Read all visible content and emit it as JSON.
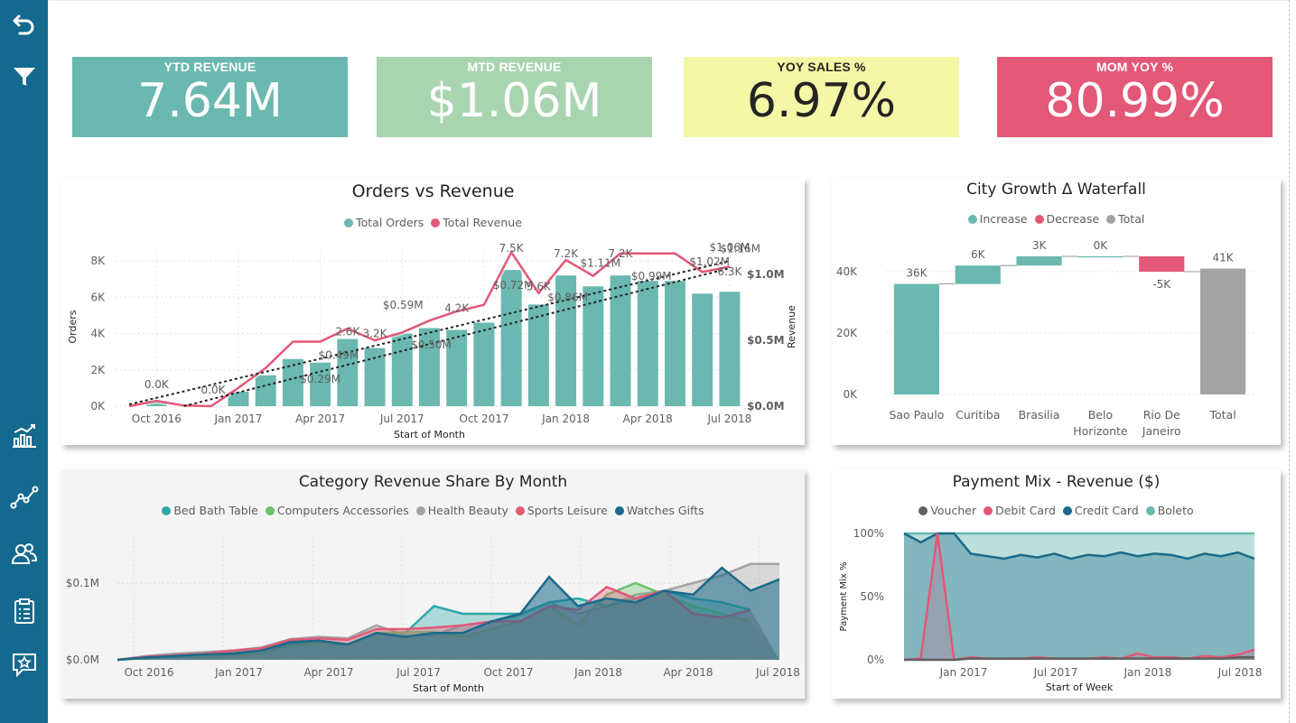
{
  "kpis": [
    {
      "label": "YTD REVENUE",
      "value": "7.64M",
      "bg": "#6ab8b0",
      "fg": "#ffffff",
      "labelColor": "#ffffff"
    },
    {
      "label": "MTD REVENUE",
      "value": "$1.06M",
      "bg": "#a8d5b0",
      "fg": "#ffffff",
      "labelColor": "#ffffff"
    },
    {
      "label": "YOY SALES %",
      "value": "6.97%",
      "bg": "#f4f7a6",
      "fg": "#252423",
      "labelColor": "#252423"
    },
    {
      "label": "MOM YOY %",
      "value": "80.99%",
      "bg": "#e35877",
      "fg": "#ffffff",
      "labelColor": "#ffffff"
    }
  ],
  "sidebar": {
    "icons": [
      "undo-icon",
      "filter-icon",
      "bar-chart-icon",
      "line-trend-icon",
      "users-icon",
      "clipboard-icon",
      "feedback-icon"
    ]
  },
  "charts": {
    "orders_revenue": {
      "title": "Orders vs Revenue",
      "legend": [
        "Total Orders",
        "Total Revenue"
      ],
      "xlabel": "Start of Month",
      "ylabel_left": "Orders",
      "ylabel_right": "Revenue",
      "xticks": [
        "Oct 2016",
        "Jan 2017",
        "Apr 2017",
        "Jul 2017",
        "Oct 2017",
        "Jan 2018",
        "Apr 2018",
        "Jul 2018"
      ],
      "yticks_left": [
        "0K",
        "2K",
        "4K",
        "6K",
        "8K"
      ],
      "yticks_right": [
        "$0.0M",
        "$0.5M",
        "$1.0M"
      ],
      "bar_labels": [
        "0.0K",
        "0.0K",
        "2.6K",
        "3.2K",
        "4.2K",
        "7.5K",
        "5.6K",
        "7.2K",
        "7.2K",
        "6.3K"
      ],
      "rev_labels": [
        "$0.29M",
        "$0.49M",
        "$0.59M",
        "$0.50M",
        "$0.72M",
        "$0.86M",
        "$1.11M",
        "$0.99M",
        "$1.02M",
        "$1.16M",
        "$1.06M"
      ]
    },
    "waterfall": {
      "title": "City Growth Δ Waterfall",
      "legend": [
        "Increase",
        "Decrease",
        "Total"
      ],
      "yticks": [
        "0K",
        "20K",
        "40K"
      ],
      "value_labels": [
        "36K",
        "6K",
        "3K",
        "0K",
        "-5K",
        "41K"
      ],
      "categories": [
        [
          "Sao Paulo"
        ],
        [
          "Curitiba"
        ],
        [
          "Brasilia"
        ],
        [
          "Belo",
          "Horizonte"
        ],
        [
          "Rio De",
          "Janeiro"
        ],
        [
          "Total"
        ]
      ]
    },
    "category_share": {
      "title": "Category Revenue Share By Month",
      "legend": [
        "Bed Bath Table",
        "Computers Accessories",
        "Health Beauty",
        "Sports Leisure",
        "Watches Gifts"
      ],
      "xlabel": "Start of Month",
      "xticks": [
        "Oct 2016",
        "Jan 2017",
        "Apr 2017",
        "Jul 2017",
        "Oct 2017",
        "Jan 2018",
        "Apr 2018",
        "Jul 2018"
      ],
      "yticks": [
        "$0.0M",
        "$0.1M"
      ]
    },
    "payment_mix": {
      "title": "Payment Mix - Revenue ($)",
      "legend": [
        "Voucher",
        "Debit Card",
        "Credit Card",
        "Boleto"
      ],
      "xlabel": "Start of Week",
      "ylabel": "Payment Mix %",
      "xticks": [
        "Jan 2017",
        "Jul 2017",
        "Jan 2018",
        "Jul 2018"
      ],
      "yticks": [
        "0%",
        "50%",
        "100%"
      ]
    }
  },
  "chart_data": [
    {
      "type": "bar",
      "title": "Orders vs Revenue",
      "xlabel": "Start of Month",
      "ylabel": "Orders",
      "ylabel_right": "Revenue",
      "categories": [
        "Sep 2016",
        "Oct 2016",
        "Nov 2016",
        "Dec 2016",
        "Jan 2017",
        "Feb 2017",
        "Mar 2017",
        "Apr 2017",
        "May 2017",
        "Jun 2017",
        "Jul 2017",
        "Aug 2017",
        "Sep 2017",
        "Oct 2017",
        "Nov 2017",
        "Dec 2017",
        "Jan 2018",
        "Feb 2018",
        "Mar 2018",
        "Apr 2018",
        "May 2018",
        "Jun 2018",
        "Jul 2018"
      ],
      "ylim": [
        0,
        8700
      ],
      "y2lim": [
        0,
        1200000
      ],
      "series": [
        {
          "name": "Total Orders",
          "values": [
            0,
            300,
            0,
            0,
            800,
            1700,
            2600,
            2400,
            3700,
            3200,
            4000,
            4300,
            4200,
            4600,
            7500,
            5600,
            7200,
            6600,
            7200,
            6900,
            6900,
            6200,
            6300
          ]
        },
        {
          "name": "Total Revenue",
          "values": [
            0,
            40000,
            5000,
            0,
            140000,
            290000,
            490000,
            490000,
            590000,
            500000,
            560000,
            650000,
            720000,
            770000,
            1170000,
            860000,
            1110000,
            990000,
            1160000,
            1160000,
            1160000,
            1020000,
            1060000
          ]
        }
      ],
      "colors": {
        "Total Orders": "#6ab8b0",
        "Total Revenue": "#e35877"
      }
    },
    {
      "type": "bar",
      "subtype": "waterfall",
      "title": "City Growth Δ Waterfall",
      "categories": [
        "Sao Paulo",
        "Curitiba",
        "Brasilia",
        "Belo Horizonte",
        "Rio De Janeiro",
        "Total"
      ],
      "values": [
        36000,
        6000,
        3000,
        0,
        -5000,
        41000
      ],
      "kinds": [
        "increase",
        "increase",
        "increase",
        "increase",
        "decrease",
        "total"
      ],
      "ylim": [
        0,
        50000
      ],
      "colors": {
        "Increase": "#6ab8b0",
        "Decrease": "#e35877",
        "Total": "#a3a3a3"
      }
    },
    {
      "type": "area",
      "title": "Category Revenue Share By Month",
      "xlabel": "Start of Month",
      "x": [
        "Sep 2016",
        "Oct 2016",
        "Nov 2016",
        "Dec 2016",
        "Jan 2017",
        "Feb 2017",
        "Mar 2017",
        "Apr 2017",
        "May 2017",
        "Jun 2017",
        "Jul 2017",
        "Aug 2017",
        "Sep 2017",
        "Oct 2017",
        "Nov 2017",
        "Dec 2017",
        "Jan 2018",
        "Feb 2018",
        "Mar 2018",
        "Apr 2018",
        "May 2018",
        "Jul 2018"
      ],
      "ylim": [
        0,
        0.16
      ],
      "series": [
        {
          "name": "Health Beauty",
          "values": [
            0,
            0.005,
            0.008,
            0.01,
            0.012,
            0.016,
            0.027,
            0.03,
            0.028,
            0.045,
            0.032,
            0.032,
            0.045,
            0.05,
            0.058,
            0.075,
            0.06,
            0.07,
            0.085,
            0.09,
            0.1,
            0.11,
            0.125,
            0.125
          ]
        },
        {
          "name": "Bed Bath Table",
          "values": [
            0,
            0.003,
            0.006,
            0.008,
            0.01,
            0.012,
            0.02,
            0.025,
            0.02,
            0.035,
            0.035,
            0.07,
            0.06,
            0.06,
            0.06,
            0.075,
            0.08,
            0.07,
            0.08,
            0.09,
            0.08,
            0.075,
            0.065
          ]
        },
        {
          "name": "Computers Accessories",
          "values": [
            0,
            0.002,
            0.004,
            0.005,
            0.006,
            0.008,
            0.018,
            0.022,
            0.02,
            0.035,
            0.036,
            0.036,
            0.03,
            0.04,
            0.05,
            0.07,
            0.045,
            0.085,
            0.1,
            0.085,
            0.07,
            0.06,
            0.05
          ]
        },
        {
          "name": "Sports Leisure",
          "values": [
            0,
            0.004,
            0.006,
            0.008,
            0.012,
            0.015,
            0.026,
            0.028,
            0.026,
            0.04,
            0.04,
            0.042,
            0.045,
            0.05,
            0.05,
            0.07,
            0.065,
            0.095,
            0.08,
            0.09,
            0.06,
            0.055,
            0.065
          ]
        },
        {
          "name": "Watches Gifts",
          "values": [
            0,
            0.003,
            0.005,
            0.007,
            0.008,
            0.012,
            0.023,
            0.025,
            0.02,
            0.035,
            0.03,
            0.035,
            0.035,
            0.05,
            0.06,
            0.108,
            0.07,
            0.08,
            0.075,
            0.09,
            0.085,
            0.12,
            0.09,
            0.105
          ]
        }
      ],
      "colors": {
        "Bed Bath Table": "#2fa8a8",
        "Computers Accessories": "#6cc06b",
        "Health Beauty": "#a3a3a3",
        "Sports Leisure": "#e35877",
        "Watches Gifts": "#1a6a8a"
      }
    },
    {
      "type": "area",
      "title": "Payment Mix - Revenue ($)",
      "xlabel": "Start of Week",
      "ylabel": "Payment Mix %",
      "ylim": [
        0,
        100
      ],
      "series": [
        {
          "name": "Boleto",
          "values": [
            100,
            100,
            100,
            100,
            100,
            100,
            100,
            100,
            100,
            100,
            100,
            100,
            100,
            100,
            100,
            100,
            100,
            100,
            100,
            100,
            100,
            100
          ]
        },
        {
          "name": "Credit Card",
          "values": [
            100,
            93,
            100,
            100,
            84,
            82,
            80,
            83,
            81,
            84,
            80,
            83,
            82,
            85,
            82,
            84,
            83,
            80,
            84,
            82,
            85,
            80
          ]
        },
        {
          "name": "Debit Card",
          "values": [
            0,
            1,
            100,
            0,
            2,
            1,
            1,
            1,
            2,
            1,
            1,
            1,
            2,
            1,
            5,
            2,
            2,
            1,
            3,
            2,
            4,
            8
          ]
        },
        {
          "name": "Voucher",
          "values": [
            0,
            0,
            0,
            0,
            1,
            1,
            1,
            1,
            1,
            1,
            1,
            1,
            1,
            1,
            1,
            1,
            1,
            1,
            1,
            1,
            2,
            2
          ]
        }
      ],
      "colors": {
        "Voucher": "#606060",
        "Debit Card": "#e35877",
        "Credit Card": "#1a6a8a",
        "Boleto": "#6ab8b0"
      }
    }
  ]
}
